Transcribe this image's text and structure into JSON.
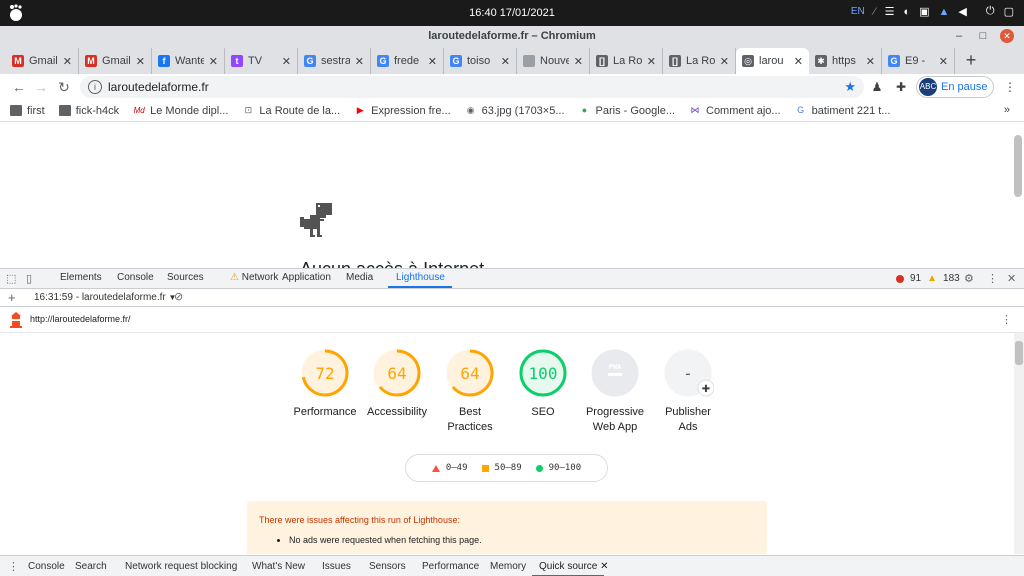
{
  "system": {
    "clock": "16:40 17/01/2021",
    "lang": "EN"
  },
  "window": {
    "title": "laroutedelaforme.fr – Chromium"
  },
  "tabs": [
    {
      "label": "Gmail",
      "icon": "gmail-icon",
      "color": "#d93025",
      "glyph": "M"
    },
    {
      "label": "Gmail",
      "icon": "gmail-icon",
      "color": "#d93025",
      "glyph": "M"
    },
    {
      "label": "Wanted",
      "icon": "facebook-icon",
      "color": "#1877f2",
      "glyph": "f"
    },
    {
      "label": "TV",
      "icon": "twitch-icon",
      "color": "#9146ff",
      "glyph": "t"
    },
    {
      "label": "sestra",
      "icon": "google-icon",
      "color": "#4285f4",
      "glyph": "G"
    },
    {
      "label": "frede",
      "icon": "google-icon",
      "color": "#4285f4",
      "glyph": "G"
    },
    {
      "label": "toiso",
      "icon": "google-icon",
      "color": "#4285f4",
      "glyph": "G"
    },
    {
      "label": "Nouvel o",
      "icon": "blank-icon",
      "color": "#9aa0a6",
      "glyph": ""
    },
    {
      "label": "La Ro",
      "icon": "page-icon",
      "color": "#5f6368",
      "glyph": "[]"
    },
    {
      "label": "La Ro",
      "icon": "page-icon",
      "color": "#5f6368",
      "glyph": "[]"
    },
    {
      "label": "larou",
      "icon": "globe-icon",
      "color": "#5f6368",
      "glyph": "◎",
      "active": true
    },
    {
      "label": "https",
      "icon": "bug-icon",
      "color": "#5f6368",
      "glyph": "✱"
    },
    {
      "label": "E9 -",
      "icon": "google-icon",
      "color": "#4285f4",
      "glyph": "G"
    }
  ],
  "toolbar": {
    "url": "laroutedelaforme.fr",
    "profile_label": "En pause"
  },
  "bookmarks": [
    {
      "label": "first",
      "icon": "folder-icon"
    },
    {
      "label": "fick-h4ck",
      "icon": "folder-icon"
    },
    {
      "label": "Le Monde dipl...",
      "icon": "lemonde-icon"
    },
    {
      "label": "La Route de la...",
      "icon": "page-icon"
    },
    {
      "label": "Expression fre...",
      "icon": "youtube-icon"
    },
    {
      "label": "63.jpg (1703×5...",
      "icon": "globe-icon"
    },
    {
      "label": "Paris - Google...",
      "icon": "maps-icon"
    },
    {
      "label": "Comment ajo...",
      "icon": "site-icon"
    },
    {
      "label": "batiment 221 t...",
      "icon": "google-icon"
    }
  ],
  "page": {
    "offline_title": "Aucun accès à Internet"
  },
  "devtools": {
    "tabs": [
      "Elements",
      "Console",
      "Sources",
      "Network",
      "Application",
      "Media",
      "Lighthouse"
    ],
    "active_tab": "Lighthouse",
    "errors": "91",
    "warnings": "183",
    "report_select": "16:31:59 - laroutedelaforme.fr",
    "report_url": "http://laroutedelaforme.fr/",
    "drawer_tabs": [
      "Console",
      "Search",
      "Network request blocking",
      "What's New",
      "Issues",
      "Sensors",
      "Performance",
      "Memory",
      "Quick source"
    ],
    "drawer_active": "Quick source"
  },
  "lighthouse": {
    "categories": [
      {
        "label1": "Performance",
        "label2": "",
        "score": 72,
        "color": "#ffa400",
        "bg": "#fff3e0"
      },
      {
        "label1": "Accessibility",
        "label2": "",
        "score": 64,
        "color": "#ffa400",
        "bg": "#fff3e0"
      },
      {
        "label1": "Best",
        "label2": "Practices",
        "score": 64,
        "color": "#ffa400",
        "bg": "#fff3e0"
      },
      {
        "label1": "SEO",
        "label2": "",
        "score": 100,
        "color": "#0cce6b",
        "bg": "#e6f9ef"
      },
      {
        "label1": "Progressive",
        "label2": "Web App",
        "score": null,
        "display": "PWA",
        "color": "#9aa0a6",
        "bg": "#e8eaed"
      },
      {
        "label1": "Publisher",
        "label2": "Ads",
        "score": null,
        "display": "-",
        "color": "#9aa0a6",
        "bg": "#f1f3f4"
      }
    ],
    "legend": [
      {
        "range": "0–49",
        "color": "#ff4e42",
        "shape": "triangle"
      },
      {
        "range": "50–89",
        "color": "#ffa400",
        "shape": "square"
      },
      {
        "range": "90–100",
        "color": "#0cce6b",
        "shape": "circle"
      }
    ],
    "warning_title": "There were issues affecting this run of Lighthouse:",
    "warning_items": [
      "No ads were requested when fetching this page."
    ]
  }
}
